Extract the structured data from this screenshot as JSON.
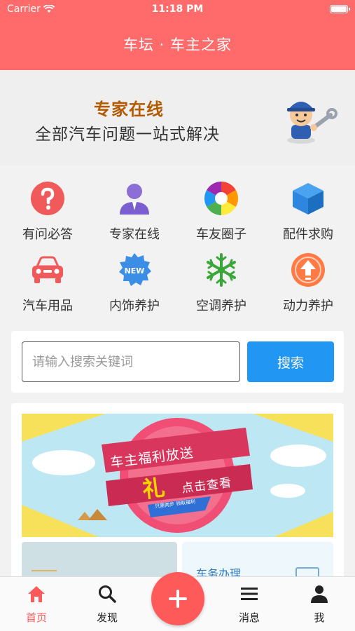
{
  "status_bar": {
    "carrier": "Carrier",
    "time": "11:18 PM"
  },
  "header": {
    "title": "车坛 · 车主之家"
  },
  "banner": {
    "line1": "专家在线",
    "line2": "全部汽车问题一站式解决"
  },
  "grid": [
    {
      "label": "有问必答",
      "icon": "question-icon"
    },
    {
      "label": "专家在线",
      "icon": "expert-icon"
    },
    {
      "label": "车友圈子",
      "icon": "aperture-icon"
    },
    {
      "label": "配件求购",
      "icon": "box-icon"
    },
    {
      "label": "汽车用品",
      "icon": "car-icon"
    },
    {
      "label": "内饰养护",
      "icon": "new-badge-icon",
      "badge": "NEW"
    },
    {
      "label": "空调养护",
      "icon": "snowflake-icon"
    },
    {
      "label": "动力养护",
      "icon": "arrow-up-icon"
    }
  ],
  "search": {
    "placeholder": "请输入搜索关键词",
    "button": "搜索"
  },
  "promo": {
    "title": "车主福利放送",
    "gift": "礼",
    "cta": "点击查看",
    "ribbon": "只需两步 领取福利"
  },
  "tiles": {
    "right_label": "车务办理"
  },
  "tabs": [
    {
      "label": "首页",
      "icon": "home-icon"
    },
    {
      "label": "发现",
      "icon": "search-icon"
    },
    {
      "label": "消息",
      "icon": "menu-icon"
    },
    {
      "label": "我",
      "icon": "user-icon"
    }
  ],
  "colors": {
    "header": "#ff6b6b",
    "accent": "#ff5a5a",
    "search_button": "#2196f3"
  }
}
